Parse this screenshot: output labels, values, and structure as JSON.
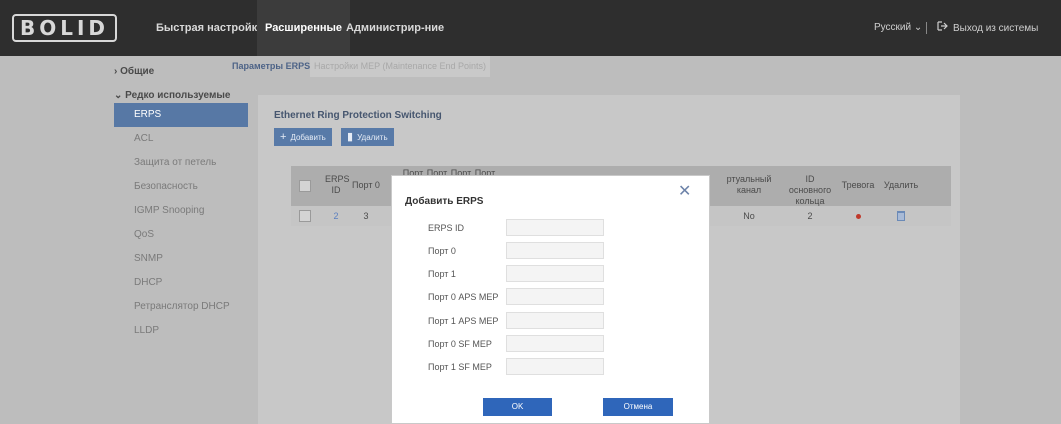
{
  "brand": {
    "logo": "BOLID"
  },
  "topnav": {
    "items": [
      {
        "label": "Быстрая настройка",
        "active": false
      },
      {
        "label": "Расширенные",
        "active": true
      },
      {
        "label": "Администрир-ние",
        "active": false
      }
    ],
    "language": "Русский",
    "language_caret": "⌄",
    "logout": "Выход из системы"
  },
  "sidebar": {
    "groups": [
      {
        "label": "Общие",
        "icon": "chevron-right-icon",
        "glyph": "›"
      },
      {
        "label": "Редко используемые",
        "icon": "chevron-down-icon",
        "glyph": "⌄"
      }
    ],
    "items": [
      {
        "label": "ERPS",
        "active": true
      },
      {
        "label": "ACL"
      },
      {
        "label": "Защита от петель"
      },
      {
        "label": "Безопасность"
      },
      {
        "label": "IGMP Snooping"
      },
      {
        "label": "QoS"
      },
      {
        "label": "SNMP"
      },
      {
        "label": "DHCP"
      },
      {
        "label": "Ретранслятор DHCP"
      },
      {
        "label": "LLDP"
      }
    ]
  },
  "content": {
    "tabs": [
      {
        "label": "Параметры ERPS",
        "active": true
      },
      {
        "label": "Настройки MEP (Maintenance End Points)",
        "active": false
      }
    ],
    "section_title": "Ethernet Ring Protection Switching",
    "add_button": "Добавить",
    "add_glyph": "+",
    "delete_button": "Удалить",
    "delete_glyph": "▮",
    "table": {
      "headers": [
        "ERPS ID",
        "Порт 0",
        "Порт 0",
        "Порт 1",
        "Порт 0",
        "Порт 1",
        "ртуальный канал",
        "ID основного кольца",
        "Тревога",
        "Удалить"
      ],
      "rows": [
        {
          "erps_id": "2",
          "port0": "3",
          "virtual_channel": "No",
          "main_ring_id": "2"
        }
      ]
    }
  },
  "dialog": {
    "title": "Добавить ERPS",
    "close_glyph": "✕",
    "fields": [
      {
        "label": "ERPS ID",
        "value": ""
      },
      {
        "label": "Порт 0",
        "value": ""
      },
      {
        "label": "Порт 1",
        "value": ""
      },
      {
        "label": "Порт 0 APS MEP",
        "value": ""
      },
      {
        "label": "Порт 1 APS MEP",
        "value": ""
      },
      {
        "label": "Порт 0 SF MEP",
        "value": ""
      },
      {
        "label": "Порт 1 SF MEP",
        "value": ""
      }
    ],
    "ok_button": "OK",
    "cancel_button": "Отмена"
  },
  "colors": {
    "topbar": "#2e2e2e",
    "accent": "#5778a5",
    "button_primary": "#2f66ba",
    "alarm": "#c0392b"
  }
}
